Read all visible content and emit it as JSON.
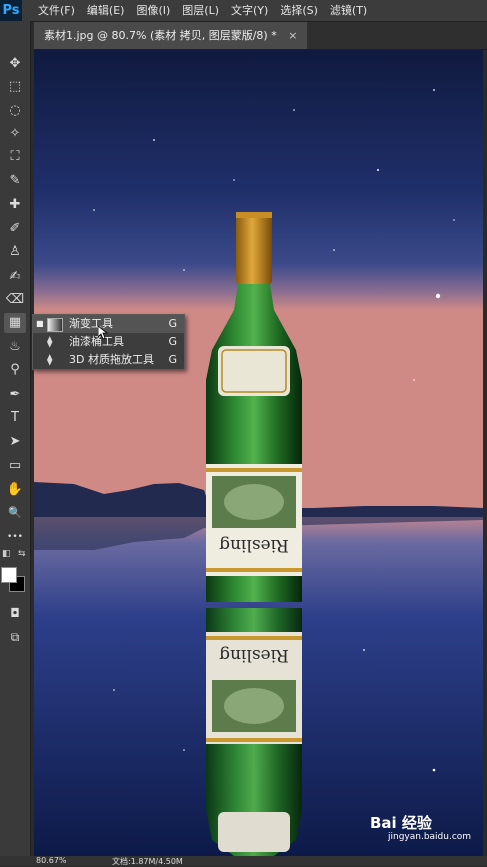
{
  "app": {
    "logo": "Ps"
  },
  "menu": [
    "文件(F)",
    "编辑(E)",
    "图像(I)",
    "图层(L)",
    "文字(Y)",
    "选择(S)",
    "滤镜(T)"
  ],
  "tab": {
    "title": "素材1.jpg @ 80.7% (素材 拷贝, 图层蒙版/8) *",
    "close": "×"
  },
  "tools": [
    {
      "name": "move-tool-icon",
      "glyph": "✥"
    },
    {
      "name": "marquee-tool-icon",
      "glyph": "⬚"
    },
    {
      "name": "lasso-tool-icon",
      "glyph": "◌"
    },
    {
      "name": "magic-wand-tool-icon",
      "glyph": "✧"
    },
    {
      "name": "crop-tool-icon",
      "glyph": "⛶"
    },
    {
      "name": "eyedropper-tool-icon",
      "glyph": "✎"
    },
    {
      "name": "healing-brush-tool-icon",
      "glyph": "✚"
    },
    {
      "name": "brush-tool-icon",
      "glyph": "✐"
    },
    {
      "name": "clone-stamp-tool-icon",
      "glyph": "♙"
    },
    {
      "name": "history-brush-tool-icon",
      "glyph": "✍"
    },
    {
      "name": "eraser-tool-icon",
      "glyph": "⌫"
    },
    {
      "name": "gradient-tool-icon",
      "glyph": "▦"
    },
    {
      "name": "blur-tool-icon",
      "glyph": "♨"
    },
    {
      "name": "dodge-tool-icon",
      "glyph": "⚲"
    },
    {
      "name": "pen-tool-icon",
      "glyph": "✒"
    },
    {
      "name": "type-tool-icon",
      "glyph": "T"
    },
    {
      "name": "path-selection-tool-icon",
      "glyph": "➤"
    },
    {
      "name": "rectangle-tool-icon",
      "glyph": "▭"
    },
    {
      "name": "hand-tool-icon",
      "glyph": "✋"
    },
    {
      "name": "zoom-tool-icon",
      "glyph": "🔍"
    },
    {
      "name": "more-tools-icon",
      "glyph": "•••"
    }
  ],
  "flyout": [
    {
      "label": "渐变工具",
      "key": "G",
      "selected": true
    },
    {
      "label": "油漆桶工具",
      "key": "G",
      "selected": false
    },
    {
      "label": "3D 材质拖放工具",
      "key": "G",
      "selected": false
    }
  ],
  "status": {
    "zoom": "80.67%",
    "doc": "文档:1.87M/4.50M"
  },
  "watermark": {
    "brand": "Bai 经验",
    "sub": "jingyan.baidu.com"
  },
  "colors": {
    "foreground": "#ffffff",
    "background": "#000000"
  }
}
